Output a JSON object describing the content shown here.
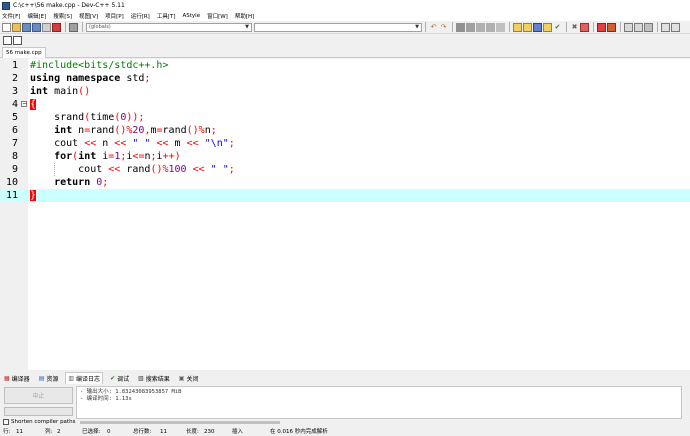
{
  "window": {
    "title": "C:\\c++\\56 make.cpp - Dev-C++ 5.11"
  },
  "menu": [
    "文件[F]",
    "编辑[E]",
    "搜索[S]",
    "视图[V]",
    "项目[P]",
    "运行[R]",
    "工具[T]",
    "AStyle",
    "窗口[W]",
    "帮助[H]"
  ],
  "toolbar": {
    "scope_combo": "(globals)",
    "symbol_combo": ""
  },
  "tabs": {
    "file": "56 make.cpp"
  },
  "editor": {
    "lines": [
      {
        "n": "1",
        "html": "<span class=\"pp\">#include&lt;bits/stdc++.h&gt;</span>"
      },
      {
        "n": "2",
        "html": "<span class=\"kw\">using namespace</span> std<span class=\"sym\">;</span>"
      },
      {
        "n": "3",
        "html": "<span class=\"kw\">int</span> main<span class=\"sym\">()</span>"
      },
      {
        "n": "4",
        "html": "<span class=\"brh\">{</span>"
      },
      {
        "n": "5",
        "html": "    srand<span class=\"sym\">(</span>time<span class=\"sym\">(</span><span class=\"num\">0</span><span class=\"sym\">));</span>"
      },
      {
        "n": "6",
        "html": "    <span class=\"kw\">int</span> n<span class=\"sym\">=</span>rand<span class=\"sym\">()%</span><span class=\"num\">20</span><span class=\"sym\">,</span>m<span class=\"sym\">=</span>rand<span class=\"sym\">()%</span>n<span class=\"sym\">;</span>"
      },
      {
        "n": "7",
        "html": "    cout <span class=\"sym\">&lt;&lt;</span> n <span class=\"sym\">&lt;&lt;</span> <span class=\"str\">\" \"</span> <span class=\"sym\">&lt;&lt;</span> m <span class=\"sym\">&lt;&lt;</span> <span class=\"str\">\"\\n\"</span><span class=\"sym\">;</span>"
      },
      {
        "n": "8",
        "html": "    <span class=\"kw\">for</span><span class=\"sym\">(</span><span class=\"kw\">int</span> i<span class=\"sym\">=</span><span class=\"num\">1</span><span class=\"sym\">;</span>i<span class=\"sym\">&lt;=</span>n<span class=\"sym\">;</span>i<span class=\"sym\">++)</span>"
      },
      {
        "n": "9",
        "html": "        cout <span class=\"sym\">&lt;&lt;</span> rand<span class=\"sym\">()%</span><span class=\"num\">100</span> <span class=\"sym\">&lt;&lt;</span> <span class=\"str\">\" \"</span><span class=\"sym\">;</span>"
      },
      {
        "n": "10",
        "html": "    <span class=\"kw\">return</span> <span class=\"num\">0</span><span class=\"sym\">;</span>"
      },
      {
        "n": "11",
        "html": "<span class=\"brh\">}</span>"
      }
    ]
  },
  "bottom_tabs": [
    "编译器",
    "资源",
    "编译日志",
    "调试",
    "搜索结果",
    "关闭"
  ],
  "bottom_panel": {
    "abort_label": "中止",
    "shorten_label": "Shorten compiler paths",
    "log_lines": [
      "- 输出大小: 1.83243083953857 MiB",
      "- 编译时间: 1.13s"
    ]
  },
  "status": {
    "row_label": "行:",
    "row": "11",
    "col_label": "列:",
    "col": "2",
    "sel_label": "已选择:",
    "sel": "0",
    "total_label": "总行数:",
    "total": "11",
    "len_label": "长度:",
    "len": "230",
    "mode": "插入",
    "parse": "在 0.016 秒内完成解析"
  },
  "colors": {
    "current_line": "#ccffff",
    "brace_highlight": "#ff0000",
    "preprocessor": "#008000",
    "number": "#800080",
    "string": "#0000ff",
    "symbol": "#ff0000"
  }
}
